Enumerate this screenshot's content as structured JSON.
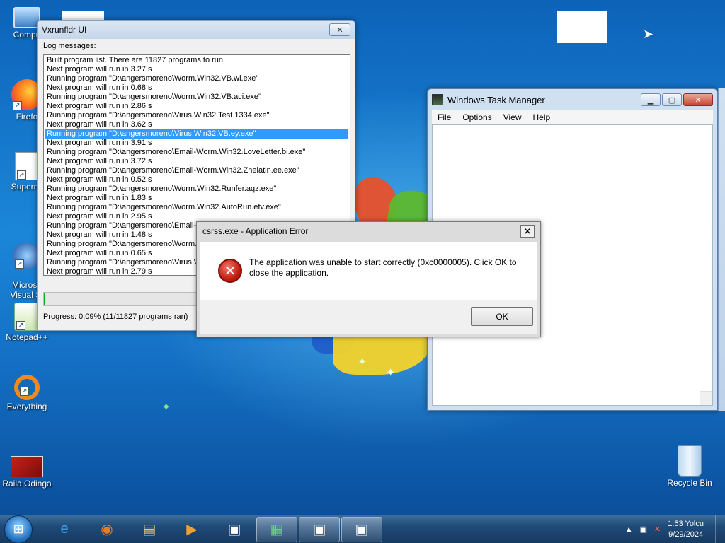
{
  "desktop": {
    "icons": [
      {
        "label": "Compu",
        "icon": "computer-icon"
      },
      {
        "label": "Firefo",
        "icon": "firefox-icon"
      },
      {
        "label": "Supermi",
        "icon": "supermium-icon"
      },
      {
        "label": "Microso\nVisual St",
        "icon": "visual-studio-icon"
      },
      {
        "label": "Notepad++",
        "icon": "notepadpp-icon"
      },
      {
        "label": "Everything",
        "icon": "everything-icon"
      },
      {
        "label": "Raila Odinga",
        "icon": "image-file-icon"
      },
      {
        "label": "Recycle Bin",
        "icon": "recycle-bin-icon"
      }
    ]
  },
  "vxrunfldr": {
    "title": "Vxrunfldr UI",
    "close_label": "✕",
    "log_label": "Log messages:",
    "log_lines": [
      "Built program list. There are 11827 programs to run.",
      "Next program will run in 3.27 s",
      "Running program \"D:\\angersmoreno\\Worm.Win32.VB.wl.exe\"",
      "Next program will run in 0.68 s",
      "Running program \"D:\\angersmoreno\\Worm.Win32.VB.aci.exe\"",
      "Next program will run in 2.86 s",
      "Running program \"D:\\angersmoreno\\Virus.Win32.Test.1334.exe\"",
      "Next program will run in 3.62 s",
      "Running program \"D:\\angersmoreno\\Virus.Win32.VB.ey.exe\"",
      "Next program will run in 3.91 s",
      "Running program \"D:\\angersmoreno\\Email-Worm.Win32.LoveLetter.bi.exe\"",
      "Next program will run in 3.72 s",
      "Running program \"D:\\angersmoreno\\Email-Worm.Win32.Zhelatin.ee.exe\"",
      "Next program will run in 0.52 s",
      "Running program \"D:\\angersmoreno\\Worm.Win32.Runfer.aqz.exe\"",
      "Next program will run in 1.83 s",
      "Running program \"D:\\angersmoreno\\Worm.Win32.AutoRun.efv.exe\"",
      "Next program will run in 2.95 s",
      "Running program \"D:\\angersmoreno\\Email-V",
      "Next program will run in 1.48 s",
      "Running program \"D:\\angersmoreno\\Worm.V",
      "Next program will run in 0.65 s",
      "Running program \"D:\\angersmoreno\\Virus.Wi",
      "Next program will run in 2.79 s"
    ],
    "selected_line_index": 8,
    "progress_fraction": 0.0009,
    "progress_text": "Progress: 0.09% (11/11827 programs ran)"
  },
  "task_manager": {
    "title": "Windows Task Manager",
    "menu": [
      "File",
      "Options",
      "View",
      "Help"
    ],
    "min_label": "▁",
    "max_label": "▢",
    "close_label": "✕"
  },
  "error_dialog": {
    "title": "csrss.exe - Application Error",
    "close_label": "✕",
    "message": "The application was unable to start correctly (0xc0000005). Click OK to close the application.",
    "ok_label": "OK",
    "icon_glyph": "✕"
  },
  "taskbar": {
    "start_glyph": "⊞",
    "apps": [
      {
        "name": "internet-explorer-icon",
        "glyph": "e",
        "color": "#3ba0e8",
        "open": false
      },
      {
        "name": "firefox-icon",
        "glyph": "◉",
        "color": "#f07a1e",
        "open": false
      },
      {
        "name": "explorer-icon",
        "glyph": "▤",
        "color": "#e8c86a",
        "open": false
      },
      {
        "name": "media-player-icon",
        "glyph": "▶",
        "color": "#f0a030",
        "open": false
      },
      {
        "name": "app-window-icon",
        "glyph": "▣",
        "color": "#ffffff",
        "open": false
      },
      {
        "name": "task-manager-icon",
        "glyph": "▦",
        "color": "#6fd36a",
        "open": true
      },
      {
        "name": "app-window-icon",
        "glyph": "▣",
        "color": "#ffffff",
        "open": true
      },
      {
        "name": "app-window-icon",
        "glyph": "▣",
        "color": "#ffffff",
        "open": true
      }
    ],
    "clock_time": "1:53 Yolcu",
    "clock_date": "9/29/2024"
  }
}
